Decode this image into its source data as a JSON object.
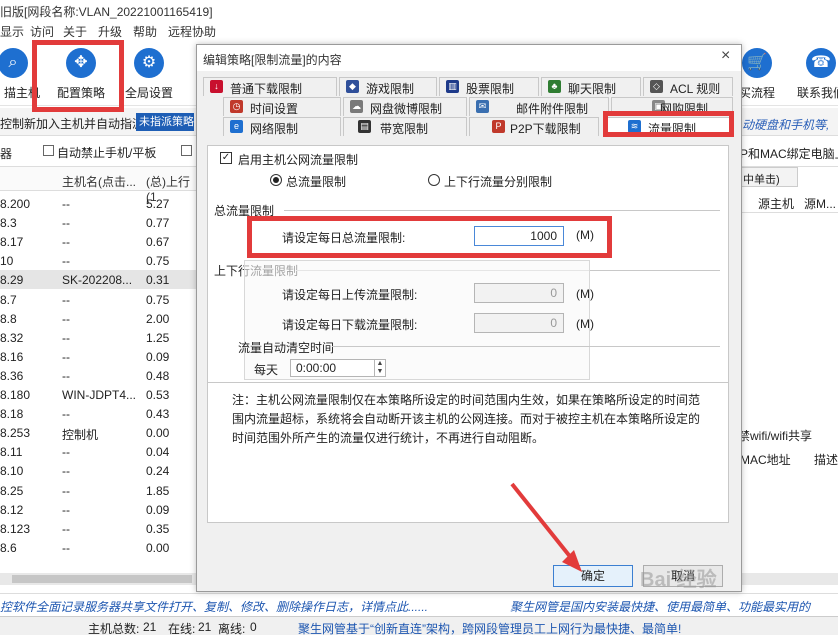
{
  "window": {
    "title": "旧版[网段名称:VLAN_20221001165419]"
  },
  "menu": [
    "显示",
    "访问",
    "关于",
    "升级",
    "帮助",
    "远程协助"
  ],
  "toolbar": {
    "buttons": [
      {
        "label": "描主机",
        "icon": "magnifier-icon"
      },
      {
        "label": "配置策略",
        "icon": "config-policy-icon"
      },
      {
        "label": "全局设置",
        "icon": "gear-icon"
      },
      {
        "label": "买流程",
        "icon": "cart-icon"
      },
      {
        "label": "联系我们",
        "icon": "phone-icon"
      }
    ]
  },
  "addbar": {
    "text": "控制新加入主机并自动指派",
    "select": "未指派策略",
    "right_text": "动硬盘和手机等,"
  },
  "chkbar": {
    "left": "器",
    "auto_block": "自动禁止手机/平板",
    "right": "P和MAC绑定电脑上"
  },
  "table": {
    "headers": [
      "主机名(点击...",
      "(总)上行(1"
    ],
    "rows": [
      {
        "ip": "8.200",
        "name": "--",
        "up": "5.27"
      },
      {
        "ip": "8.3",
        "name": "--",
        "up": "0.77"
      },
      {
        "ip": "8.17",
        "name": "--",
        "up": "0.67"
      },
      {
        "ip": "10",
        "name": "--",
        "up": "0.75"
      },
      {
        "ip": "8.29",
        "name": "SK-202208...",
        "up": "0.31"
      },
      {
        "ip": "8.7",
        "name": "--",
        "up": "0.75"
      },
      {
        "ip": "8.8",
        "name": "--",
        "up": "2.00"
      },
      {
        "ip": "8.32",
        "name": "--",
        "up": "1.25"
      },
      {
        "ip": "8.16",
        "name": "--",
        "up": "0.09"
      },
      {
        "ip": "8.36",
        "name": "--",
        "up": "0.48"
      },
      {
        "ip": "8.180",
        "name": "WIN-JDPT4...",
        "up": "0.53"
      },
      {
        "ip": "8.18",
        "name": "--",
        "up": "0.43"
      },
      {
        "ip": "8.253",
        "name": "控制机",
        "up": "0.00"
      },
      {
        "ip": "8.11",
        "name": "--",
        "up": "0.04"
      },
      {
        "ip": "8.10",
        "name": "--",
        "up": "0.24"
      },
      {
        "ip": "8.25",
        "name": "--",
        "up": "1.85"
      },
      {
        "ip": "8.12",
        "name": "--",
        "up": "0.09"
      },
      {
        "ip": "8.123",
        "name": "--",
        "up": "0.35"
      },
      {
        "ip": "8.6",
        "name": "--",
        "up": "0.00"
      }
    ]
  },
  "right_panel": {
    "tab": "中单击)",
    "col1": "源主机",
    "col2": "源M...",
    "wifi": "禁wifi/wifi共享",
    "mac": "MAC地址",
    "desc": "描述"
  },
  "marquee": {
    "left": "控软件全面记录服务器共享文件打开、复制、修改、删除操作日志，详情点此......",
    "right": "聚生网管是国内安装最快捷、使用最简单、功能最实用的"
  },
  "status": {
    "total_label": "主机总数:",
    "total": "21",
    "online_label": "在线:",
    "online": "21",
    "offline_label": "离线:",
    "offline": "0",
    "slogan": "聚生网管基于“创新直连”架构，跨网段管理员工上网行为最快捷、最简单!"
  },
  "dialog": {
    "title": "编辑策略[限制流量]的内容",
    "close": "×",
    "tabs_row1": [
      {
        "label": "普通下载限制",
        "icon": "download-icon",
        "color": "#c8102e"
      },
      {
        "label": "游戏限制",
        "icon": "game-icon",
        "color": "#2f4f9a"
      },
      {
        "label": "股票限制",
        "icon": "stock-icon",
        "color": "#1e3a8a"
      },
      {
        "label": "聊天限制",
        "icon": "chat-icon",
        "color": "#2f7d32"
      },
      {
        "label": "ACL 规则",
        "icon": "tag-icon",
        "color": "#555555"
      }
    ],
    "tabs_row2": [
      {
        "label": "时间设置",
        "icon": "clock-icon",
        "color": "#c0392b"
      },
      {
        "label": "网盘微博限制",
        "icon": "cloud-icon",
        "color": "#7a7a7a"
      },
      {
        "label": "邮件附件限制",
        "icon": "mail-icon",
        "color": "#3a6fb0"
      },
      {
        "label": "网购限制",
        "icon": "shop-icon",
        "color": "#888888"
      }
    ],
    "tabs_row3": [
      {
        "label": "网络限制",
        "icon": "ie-icon",
        "color": "#1e6fd0"
      },
      {
        "label": "带宽限制",
        "icon": "bandwidth-icon",
        "color": "#333333"
      },
      {
        "label": "P2P下载限制",
        "icon": "p2p-icon",
        "color": "#c0392b"
      },
      {
        "label": "流量限制",
        "icon": "traffic-icon",
        "color": "#1e6fd0"
      }
    ],
    "enable_label": "启用主机公网流量限制",
    "radio_total": "总流量限制",
    "radio_split": "上下行流量分别限制",
    "section_total": "总流量限制",
    "daily_total_label": "请设定每日总流量限制:",
    "daily_total_value": "1000",
    "unit": "(M)",
    "section_updown": "上下行流量限制",
    "daily_up_label": "请设定每日上传流量限制:",
    "daily_up_value": "0",
    "daily_down_label": "请设定每日下载流量限制:",
    "daily_down_value": "0",
    "section_clear": "流量自动清空时间",
    "everyday_label": "每天",
    "clear_time": "0:00:00",
    "note": "注：主机公网流量限制仅在本策略所设定的时间范围内生效，如果在策略所设定的时间范围内流量超标，系统将会自动断开该主机的公网连接。而对于被控主机在本策略所设定的时间范围外所产生的流量仅进行统计，不再进行自动阻断。",
    "ok": "确定",
    "cancel": "取消"
  },
  "watermark": "Bai 经验",
  "colors": {
    "highlight": "#e23b3b",
    "accent": "#1e6fd0",
    "link": "#1d56b0"
  }
}
